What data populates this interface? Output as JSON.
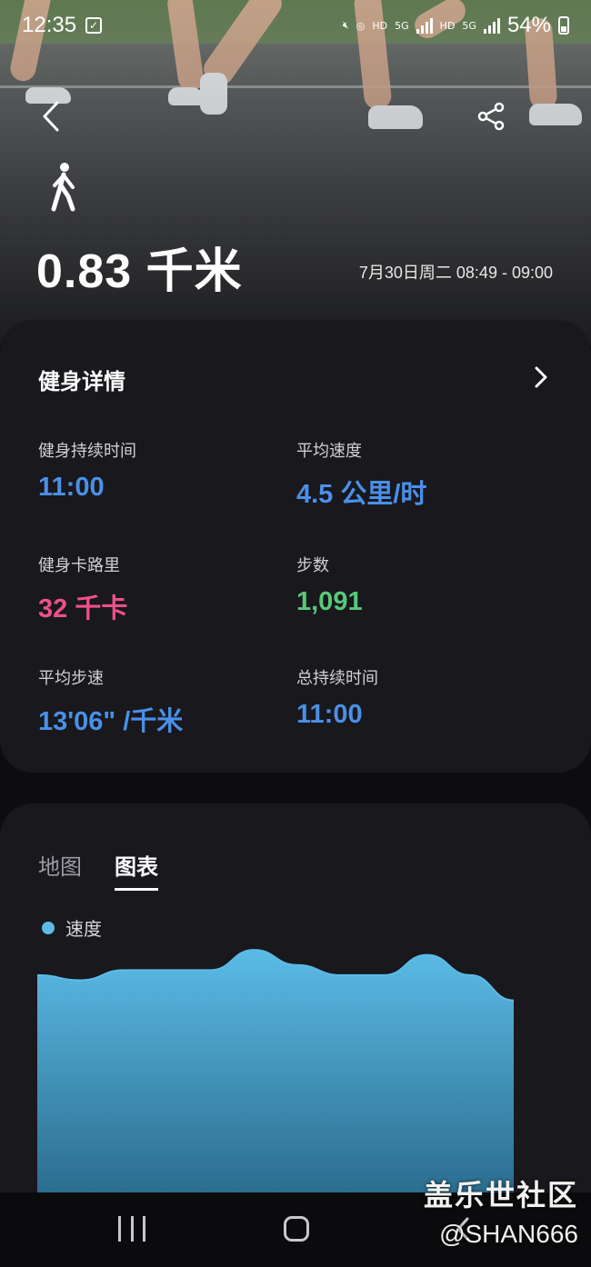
{
  "status_bar": {
    "time": "12:35",
    "battery": "54%",
    "icons": [
      "checkbox-icon",
      "mute-icon",
      "hotspot-icon",
      "hd-icon",
      "5g-icon",
      "signal-icon",
      "battery-icon"
    ]
  },
  "header": {
    "distance": "0.83 千米",
    "datetime": "7月30日周二 08:49 - 09:00"
  },
  "details": {
    "title": "健身详情",
    "stats": [
      {
        "label": "健身持续时间",
        "value": "11:00",
        "color": "#4a90e8"
      },
      {
        "label": "平均速度",
        "value": "4.5 公里/时",
        "color": "#4a90e8"
      },
      {
        "label": "健身卡路里",
        "value": "32 千卡",
        "color": "#f0508a"
      },
      {
        "label": "步数",
        "value": "1,091",
        "color": "#57c97a"
      },
      {
        "label": "平均步速",
        "value": "13'06\" /千米",
        "color": "#4a90e8"
      },
      {
        "label": "总持续时间",
        "value": "11:00",
        "color": "#4a90e8"
      }
    ]
  },
  "chart_section": {
    "tabs": [
      {
        "label": "地图",
        "active": false
      },
      {
        "label": "图表",
        "active": true
      }
    ],
    "legend": "速度"
  },
  "chart_data": {
    "type": "area",
    "series": [
      {
        "name": "速度",
        "values": [
          4.3,
          4.2,
          4.4,
          4.4,
          4.4,
          4.8,
          4.5,
          4.3,
          4.3,
          4.7,
          4.3,
          3.8
        ]
      }
    ],
    "color": "#5bbbe6",
    "ylim": [
      0,
      5
    ]
  },
  "watermark": {
    "line1": "盖乐世社区",
    "line2": "@SHAN666"
  }
}
